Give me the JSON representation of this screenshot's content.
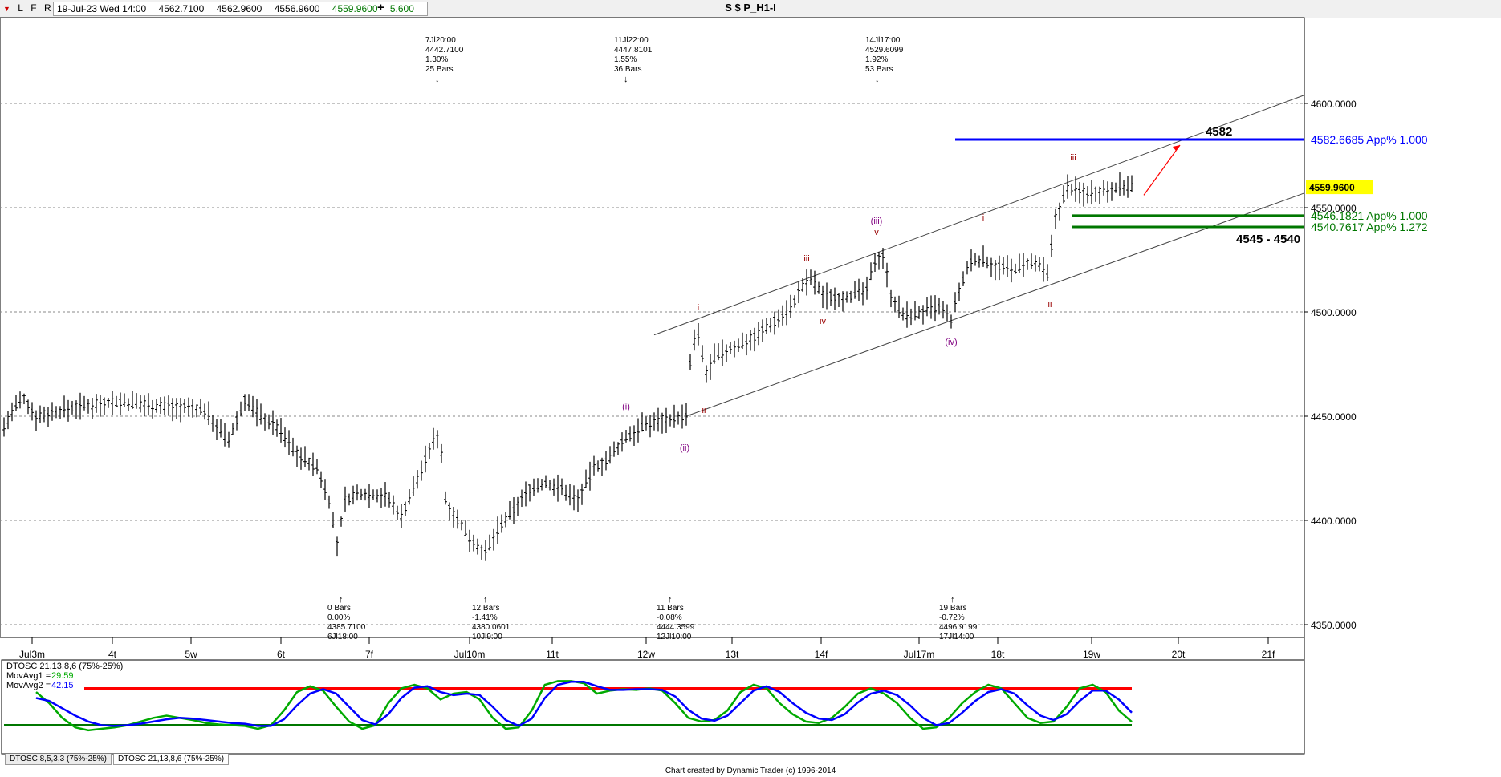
{
  "window": {
    "title": "S $ P_H1-I"
  },
  "toolbar": {
    "btn_down": "▼",
    "btn_l": "L",
    "btn_f": "F",
    "btn_r": "R",
    "add": "+"
  },
  "ohlc": {
    "date": "19-Jul-23 Wed 14:00",
    "open": "4562.7100",
    "high": "4562.9600",
    "low": "4556.9600",
    "close": "4559.9600",
    "range": "5.600"
  },
  "colors": {
    "price": "#000000",
    "blue": "#0000ff",
    "green": "#007700",
    "red": "#ff0000",
    "purple": "#800080",
    "maroon": "#990000",
    "osc_green": "#00aa00",
    "osc_blue": "#0000ff",
    "last_bg": "#ffff00"
  },
  "chart_data": [
    {
      "type": "bar",
      "series": [
        {
          "name": "S $ P_H1-I",
          "values": []
        }
      ],
      "ylim": [
        4345,
        4620
      ],
      "y_ticks": [
        4350,
        4400,
        4450,
        4500,
        4550,
        4600
      ],
      "y_tick_labels": [
        "4350.0000",
        "4400.0000",
        "4450.0000",
        "4500.0000",
        "4550.0000",
        "4600.0000"
      ],
      "x_tick_labels": [
        "Jul3m",
        "4t",
        "5w",
        "6t",
        "7f",
        "Jul10m",
        "11t",
        "12w",
        "13t",
        "14f",
        "Jul17m",
        "18t",
        "19w",
        "20t",
        "21f"
      ],
      "last_price": "4559.9600",
      "levels": [
        {
          "value": 4582.6685,
          "label": "4582.6685 App% 1.000",
          "color": "blue"
        },
        {
          "value": 4546.1821,
          "label": "4546.1821 App% 1.000",
          "color": "green"
        },
        {
          "value": 4540.7617,
          "label": "4540.7617 App% 1.272",
          "color": "green"
        }
      ],
      "level_notes": [
        "4582",
        "4545 - 4540"
      ],
      "swings_top": [
        {
          "lines": [
            "7Jl20:00",
            "4442.7100",
            "1.30%",
            "25 Bars"
          ]
        },
        {
          "lines": [
            "11Jl22:00",
            "4447.8101",
            "1.55%",
            "36 Bars"
          ]
        },
        {
          "lines": [
            "14Jl17:00",
            "4529.6099",
            "1.92%",
            "53 Bars"
          ]
        }
      ],
      "swings_bottom": [
        {
          "lines": [
            "0 Bars",
            "0.00%",
            "4385.7100",
            "6Jl18:00"
          ]
        },
        {
          "lines": [
            "12 Bars",
            "-1.41%",
            "4380.0601",
            "10Jl9:00"
          ]
        },
        {
          "lines": [
            "11 Bars",
            "-0.08%",
            "4444.3599",
            "12Jl10:00"
          ]
        },
        {
          "lines": [
            "19 Bars",
            "-0.72%",
            "4496.9199",
            "17Jl14:00"
          ]
        }
      ],
      "waves": [
        {
          "label": "(i)",
          "price": 4451
        },
        {
          "label": "(ii)",
          "price": 4442
        },
        {
          "label": "i",
          "price": 4497
        },
        {
          "label": "ii",
          "price": 4460
        },
        {
          "label": "iii",
          "price": 4522
        },
        {
          "label": "iv",
          "price": 4502
        },
        {
          "label": "v",
          "price": 4533
        },
        {
          "label": "(iii)",
          "price": 4540
        },
        {
          "label": "(iv)",
          "price": 4492
        },
        {
          "label": "i",
          "price": 4540
        },
        {
          "label": "ii",
          "price": 4510
        },
        {
          "label": "iii",
          "price": 4568
        }
      ]
    },
    {
      "type": "line",
      "title": "DTOSC 21,13,8,6 (75%-25%)",
      "ylim": [
        -5,
        105
      ],
      "bands": [
        75,
        25
      ],
      "series": [
        {
          "name": "MovAvg1",
          "last_value": "29.59",
          "values": [
            70,
            55,
            35,
            22,
            18,
            20,
            22,
            25,
            30,
            35,
            38,
            35,
            32,
            28,
            26,
            25,
            24,
            20,
            25,
            45,
            70,
            78,
            72,
            50,
            30,
            20,
            25,
            55,
            75,
            80,
            75,
            60,
            68,
            70,
            60,
            35,
            20,
            22,
            45,
            80,
            85,
            85,
            82,
            68,
            72,
            74,
            73,
            75,
            72,
            55,
            35,
            30,
            32,
            45,
            70,
            80,
            75,
            55,
            40,
            30,
            28,
            35,
            50,
            68,
            75,
            68,
            55,
            35,
            20,
            22,
            35,
            55,
            70,
            80,
            75,
            55,
            35,
            28,
            30,
            50,
            75,
            80,
            70,
            45,
            29.59
          ]
        },
        {
          "name": "MovAvg2",
          "last_value": "42.15",
          "values": [
            62,
            58,
            48,
            38,
            30,
            25,
            24,
            25,
            27,
            30,
            33,
            35,
            34,
            32,
            30,
            28,
            27,
            24,
            24,
            33,
            52,
            68,
            74,
            68,
            50,
            32,
            26,
            40,
            62,
            76,
            78,
            70,
            66,
            68,
            66,
            50,
            32,
            24,
            34,
            62,
            80,
            84,
            84,
            78,
            73,
            73,
            74,
            74,
            73,
            64,
            46,
            34,
            31,
            38,
            55,
            72,
            78,
            70,
            55,
            42,
            34,
            32,
            40,
            56,
            68,
            72,
            66,
            52,
            35,
            25,
            28,
            42,
            58,
            70,
            74,
            68,
            52,
            38,
            32,
            40,
            58,
            72,
            72,
            60,
            42.15
          ]
        }
      ],
      "tabs": [
        "DTOSC 8,5,3,3 (75%-25%)",
        "DTOSC 21,13,8,6 (75%-25%)"
      ]
    }
  ],
  "footer": {
    "credit": "Chart created by Dynamic Trader  (c)  1996-2014"
  }
}
